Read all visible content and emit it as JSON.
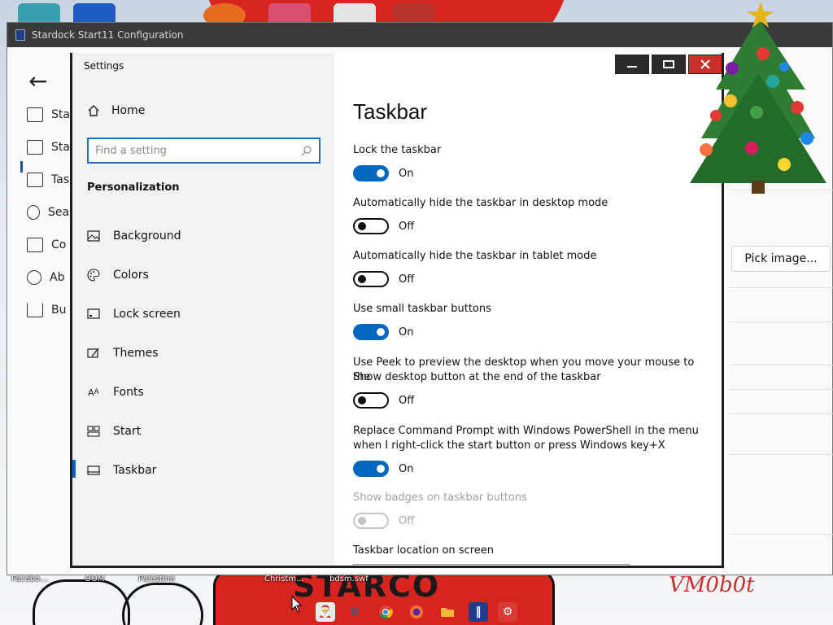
{
  "desktop": {
    "wallpaper_text": "STARCO",
    "signature": "VM0b0t",
    "icon_labels": [
      "Facebo...",
      "OOM",
      "Palestine",
      "Christm...",
      "bdsm.swf"
    ]
  },
  "start11": {
    "title": "Stardock Start11 Configuration",
    "nav_items": [
      {
        "label": "Sta",
        "icon": "start-menu-icon"
      },
      {
        "label": "Sta",
        "icon": "start-button-icon"
      },
      {
        "label": "Tas",
        "icon": "taskbar-icon"
      },
      {
        "label": "Sea",
        "icon": "search-icon"
      },
      {
        "label": "Co",
        "icon": "control-icon"
      },
      {
        "label": "Ab",
        "icon": "about-icon"
      },
      {
        "label": "Bu",
        "icon": "cart-icon"
      }
    ],
    "pick_image_label": "Pick image..."
  },
  "settings": {
    "window_title": "Settings",
    "home_label": "Home",
    "search_placeholder": "Find a setting",
    "section_title": "Personalization",
    "nav_items": [
      {
        "label": "Background",
        "icon": "background-icon"
      },
      {
        "label": "Colors",
        "icon": "palette-icon"
      },
      {
        "label": "Lock screen",
        "icon": "lock-screen-icon"
      },
      {
        "label": "Themes",
        "icon": "themes-icon"
      },
      {
        "label": "Fonts",
        "icon": "fonts-icon"
      },
      {
        "label": "Start",
        "icon": "start-icon"
      },
      {
        "label": "Taskbar",
        "icon": "taskbar-icon",
        "selected": true
      }
    ],
    "page_title": "Taskbar",
    "options": [
      {
        "label": "Lock the taskbar",
        "state": "On",
        "enabled": true
      },
      {
        "label": "Automatically hide the taskbar in desktop mode",
        "state": "Off",
        "enabled": true
      },
      {
        "label": "Automatically hide the taskbar in tablet mode",
        "state": "Off",
        "enabled": true
      },
      {
        "label": "Use small taskbar buttons",
        "state": "On",
        "enabled": true
      },
      {
        "label_line1": "Use Peek to preview the desktop when you move your mouse to the",
        "label_line2": "Show desktop button at the end of the taskbar",
        "state": "Off",
        "enabled": true
      },
      {
        "label_line1": "Replace Command Prompt with Windows PowerShell in the menu",
        "label_line2": "when I right-click the start button or press Windows key+X",
        "state": "On",
        "enabled": true
      },
      {
        "label": "Show badges on taskbar buttons",
        "state": "Off",
        "enabled": false
      }
    ],
    "location_label": "Taskbar location on screen",
    "accent_color": "#0067c0"
  },
  "taskbar_icons": [
    "xmas-start-icon",
    "task-view-icon",
    "chrome-icon",
    "firefox-icon",
    "file-explorer-icon",
    "start11-icon",
    "settings-icon"
  ]
}
